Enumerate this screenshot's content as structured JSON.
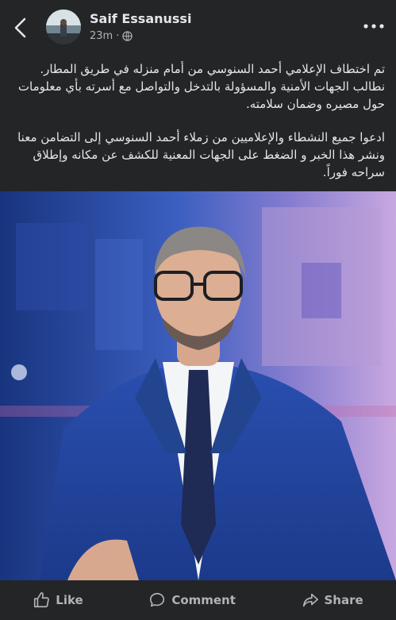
{
  "post": {
    "author": "Saif Essanussi",
    "time": "23m",
    "separator": "·",
    "paragraphs": [
      "تم اختطاف الإعلامي أحمد السنوسي من أمام منزله في طريق المطار. نطالب الجهات الأمنية والمسؤولة بالتدخل والتواصل مع أسرته بأي معلومات حول مصيره وضمان سلامته.",
      "ادعوا جميع النشطاء والإعلاميين من زملاء أحمد السنوسي إلى التضامن معنا ونشر هذا الخبر و الضغط على الجهات المعنية للكشف عن مكانه وإطلاق سراحه فوراً."
    ]
  },
  "actions": {
    "like": "Like",
    "comment": "Comment",
    "share": "Share"
  },
  "icons": [
    "back-icon",
    "globe-icon",
    "more-icon",
    "like-icon",
    "comment-icon",
    "share-icon"
  ]
}
